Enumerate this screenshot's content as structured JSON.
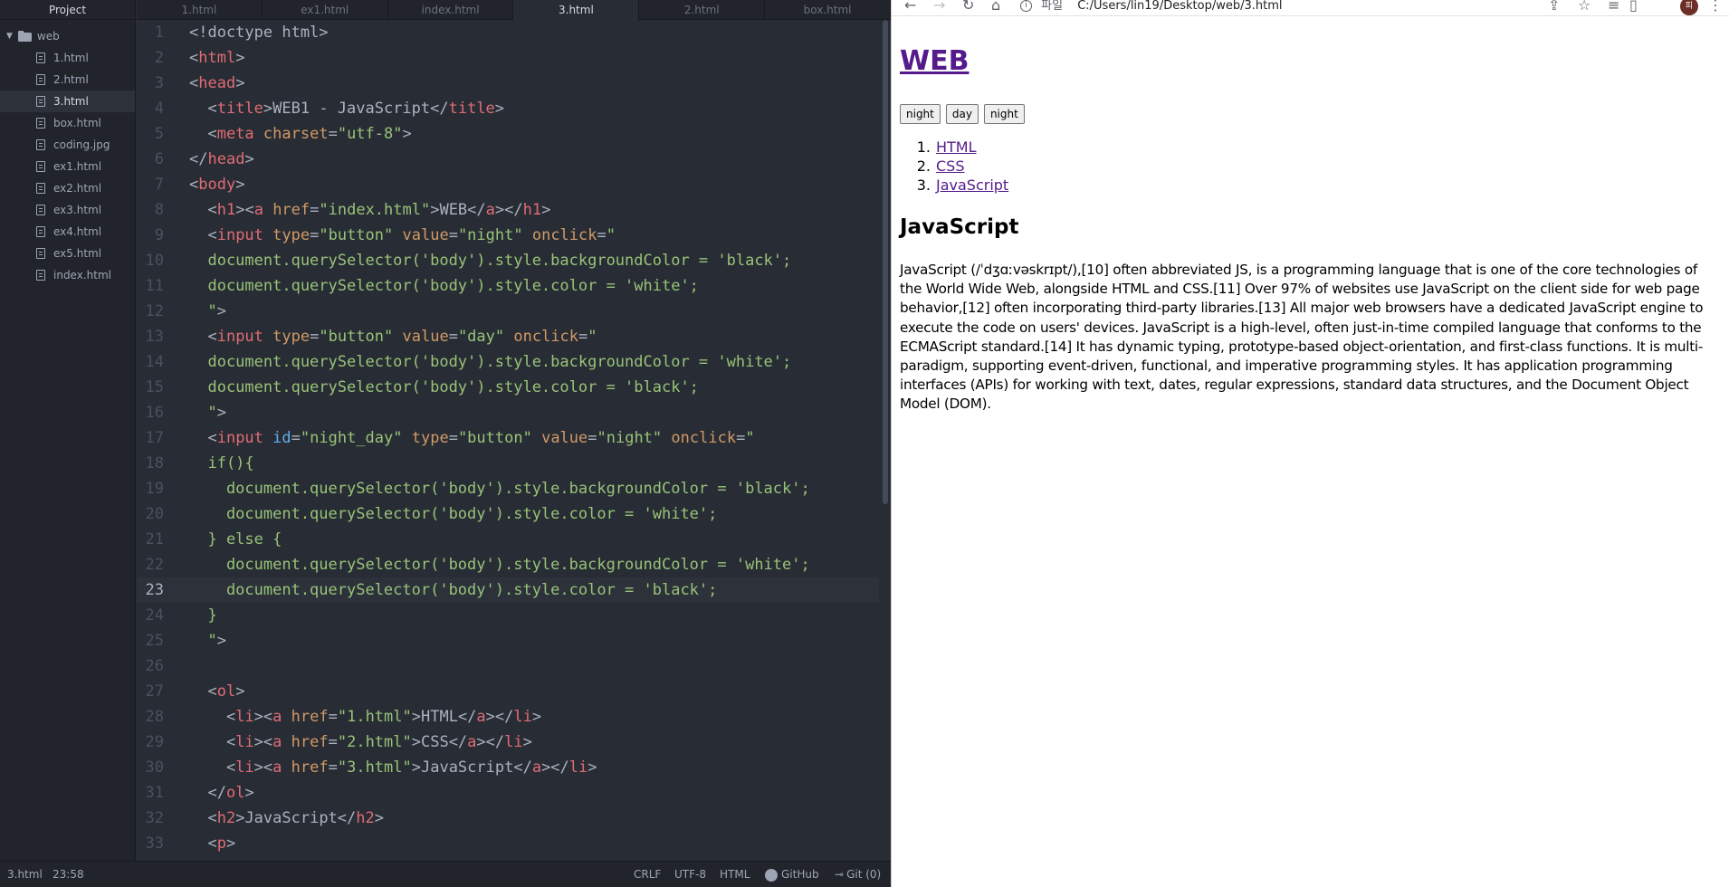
{
  "editor": {
    "tree": {
      "header": "Project",
      "folder": "web",
      "files": [
        "1.html",
        "2.html",
        "3.html",
        "box.html",
        "coding.jpg",
        "ex1.html",
        "ex2.html",
        "ex3.html",
        "ex4.html",
        "ex5.html",
        "index.html"
      ],
      "selected_index": 2
    },
    "tabs": [
      "1.html",
      "ex1.html",
      "index.html",
      "3.html",
      "2.html",
      "box.html"
    ],
    "active_tab_index": 3,
    "current_line": 23,
    "lines": [
      [
        [
          "t-doc",
          "<!doctype html>"
        ]
      ],
      [
        [
          "t-doc",
          "<"
        ],
        [
          "t-tag",
          "html"
        ],
        [
          "t-doc",
          ">"
        ]
      ],
      [
        [
          "t-doc",
          "<"
        ],
        [
          "t-tag",
          "head"
        ],
        [
          "t-doc",
          ">"
        ]
      ],
      [
        [
          "t-doc",
          "  <"
        ],
        [
          "t-tag",
          "title"
        ],
        [
          "t-doc",
          ">WEB1 - JavaScript</"
        ],
        [
          "t-tag",
          "title"
        ],
        [
          "t-doc",
          ">"
        ]
      ],
      [
        [
          "t-doc",
          "  <"
        ],
        [
          "t-tag",
          "meta"
        ],
        [
          "t-doc",
          " "
        ],
        [
          "t-attr",
          "charset"
        ],
        [
          "t-doc",
          "="
        ],
        [
          "t-str",
          "\"utf-8\""
        ],
        [
          "t-doc",
          ">"
        ]
      ],
      [
        [
          "t-doc",
          "</"
        ],
        [
          "t-tag",
          "head"
        ],
        [
          "t-doc",
          ">"
        ]
      ],
      [
        [
          "t-doc",
          "<"
        ],
        [
          "t-tag",
          "body"
        ],
        [
          "t-doc",
          ">"
        ]
      ],
      [
        [
          "t-doc",
          "  <"
        ],
        [
          "t-tag",
          "h1"
        ],
        [
          "t-doc",
          "><"
        ],
        [
          "t-tag",
          "a"
        ],
        [
          "t-doc",
          " "
        ],
        [
          "t-attr",
          "href"
        ],
        [
          "t-doc",
          "="
        ],
        [
          "t-str",
          "\"index.html\""
        ],
        [
          "t-doc",
          ">WEB</"
        ],
        [
          "t-tag",
          "a"
        ],
        [
          "t-doc",
          "></"
        ],
        [
          "t-tag",
          "h1"
        ],
        [
          "t-doc",
          ">"
        ]
      ],
      [
        [
          "t-doc",
          "  <"
        ],
        [
          "t-tag",
          "input"
        ],
        [
          "t-doc",
          " "
        ],
        [
          "t-attr",
          "type"
        ],
        [
          "t-doc",
          "="
        ],
        [
          "t-str",
          "\"button\""
        ],
        [
          "t-doc",
          " "
        ],
        [
          "t-attr",
          "value"
        ],
        [
          "t-doc",
          "="
        ],
        [
          "t-str",
          "\"night\""
        ],
        [
          "t-doc",
          " "
        ],
        [
          "t-attr",
          "onclick"
        ],
        [
          "t-doc",
          "="
        ],
        [
          "t-str",
          "\""
        ]
      ],
      [
        [
          "t-str",
          "  document.querySelector('body').style.backgroundColor = 'black';"
        ]
      ],
      [
        [
          "t-str",
          "  document.querySelector('body').style.color = 'white';"
        ]
      ],
      [
        [
          "t-str",
          "  \""
        ],
        [
          "t-doc",
          ">"
        ]
      ],
      [
        [
          "t-doc",
          "  <"
        ],
        [
          "t-tag",
          "input"
        ],
        [
          "t-doc",
          " "
        ],
        [
          "t-attr",
          "type"
        ],
        [
          "t-doc",
          "="
        ],
        [
          "t-str",
          "\"button\""
        ],
        [
          "t-doc",
          " "
        ],
        [
          "t-attr",
          "value"
        ],
        [
          "t-doc",
          "="
        ],
        [
          "t-str",
          "\"day\""
        ],
        [
          "t-doc",
          " "
        ],
        [
          "t-attr",
          "onclick"
        ],
        [
          "t-doc",
          "="
        ],
        [
          "t-str",
          "\""
        ]
      ],
      [
        [
          "t-str",
          "  document.querySelector('body').style.backgroundColor = 'white';"
        ]
      ],
      [
        [
          "t-str",
          "  document.querySelector('body').style.color = 'black';"
        ]
      ],
      [
        [
          "t-str",
          "  \""
        ],
        [
          "t-doc",
          ">"
        ]
      ],
      [
        [
          "t-doc",
          "  <"
        ],
        [
          "t-tag",
          "input"
        ],
        [
          "t-doc",
          " "
        ],
        [
          "t-id",
          "id"
        ],
        [
          "t-doc",
          "="
        ],
        [
          "t-str",
          "\"night_day\""
        ],
        [
          "t-doc",
          " "
        ],
        [
          "t-attr",
          "type"
        ],
        [
          "t-doc",
          "="
        ],
        [
          "t-str",
          "\"button\""
        ],
        [
          "t-doc",
          " "
        ],
        [
          "t-attr",
          "value"
        ],
        [
          "t-doc",
          "="
        ],
        [
          "t-str",
          "\"night\""
        ],
        [
          "t-doc",
          " "
        ],
        [
          "t-attr",
          "onclick"
        ],
        [
          "t-doc",
          "="
        ],
        [
          "t-str",
          "\""
        ]
      ],
      [
        [
          "t-str",
          "  if(){"
        ]
      ],
      [
        [
          "t-str",
          "    document.querySelector('body').style.backgroundColor = 'black';"
        ]
      ],
      [
        [
          "t-str",
          "    document.querySelector('body').style.color = 'white';"
        ]
      ],
      [
        [
          "t-str",
          "  } else {"
        ]
      ],
      [
        [
          "t-str",
          "    document.querySelector('body').style.backgroundColor = 'white';"
        ]
      ],
      [
        [
          "t-str",
          "    document.querySelector('body').style.color = 'black';"
        ]
      ],
      [
        [
          "t-str",
          "  }"
        ]
      ],
      [
        [
          "t-str",
          "  \""
        ],
        [
          "t-doc",
          ">"
        ]
      ],
      [],
      [
        [
          "t-doc",
          "  <"
        ],
        [
          "t-tag",
          "ol"
        ],
        [
          "t-doc",
          ">"
        ]
      ],
      [
        [
          "t-doc",
          "    <"
        ],
        [
          "t-tag",
          "li"
        ],
        [
          "t-doc",
          "><"
        ],
        [
          "t-tag",
          "a"
        ],
        [
          "t-doc",
          " "
        ],
        [
          "t-attr",
          "href"
        ],
        [
          "t-doc",
          "="
        ],
        [
          "t-str",
          "\"1.html\""
        ],
        [
          "t-doc",
          ">HTML</"
        ],
        [
          "t-tag",
          "a"
        ],
        [
          "t-doc",
          "></"
        ],
        [
          "t-tag",
          "li"
        ],
        [
          "t-doc",
          ">"
        ]
      ],
      [
        [
          "t-doc",
          "    <"
        ],
        [
          "t-tag",
          "li"
        ],
        [
          "t-doc",
          "><"
        ],
        [
          "t-tag",
          "a"
        ],
        [
          "t-doc",
          " "
        ],
        [
          "t-attr",
          "href"
        ],
        [
          "t-doc",
          "="
        ],
        [
          "t-str",
          "\"2.html\""
        ],
        [
          "t-doc",
          ">CSS</"
        ],
        [
          "t-tag",
          "a"
        ],
        [
          "t-doc",
          "></"
        ],
        [
          "t-tag",
          "li"
        ],
        [
          "t-doc",
          ">"
        ]
      ],
      [
        [
          "t-doc",
          "    <"
        ],
        [
          "t-tag",
          "li"
        ],
        [
          "t-doc",
          "><"
        ],
        [
          "t-tag",
          "a"
        ],
        [
          "t-doc",
          " "
        ],
        [
          "t-attr",
          "href"
        ],
        [
          "t-doc",
          "="
        ],
        [
          "t-str",
          "\"3.html\""
        ],
        [
          "t-doc",
          ">JavaScript</"
        ],
        [
          "t-tag",
          "a"
        ],
        [
          "t-doc",
          "></"
        ],
        [
          "t-tag",
          "li"
        ],
        [
          "t-doc",
          ">"
        ]
      ],
      [
        [
          "t-doc",
          "  </"
        ],
        [
          "t-tag",
          "ol"
        ],
        [
          "t-doc",
          ">"
        ]
      ],
      [
        [
          "t-doc",
          "  <"
        ],
        [
          "t-tag",
          "h2"
        ],
        [
          "t-doc",
          ">JavaScript</"
        ],
        [
          "t-tag",
          "h2"
        ],
        [
          "t-doc",
          ">"
        ]
      ],
      [
        [
          "t-doc",
          "  <"
        ],
        [
          "t-tag",
          "p"
        ],
        [
          "t-doc",
          ">"
        ]
      ]
    ],
    "status": {
      "file": "3.html",
      "cursor": "23:58",
      "line_ending": "CRLF",
      "encoding": "UTF-8",
      "grammar": "HTML",
      "github": "GitHub",
      "git": "Git (0)"
    }
  },
  "browser": {
    "omnibox": {
      "info_label": "i",
      "scheme_label": "파일",
      "url": "C:/Users/lin19/Desktop/web/3.html"
    },
    "avatar_initial": "피",
    "page": {
      "h1": "WEB",
      "buttons": [
        "night",
        "day",
        "night"
      ],
      "list": [
        "HTML",
        "CSS",
        "JavaScript"
      ],
      "h2": "JavaScript",
      "paragraph": "JavaScript (/ˈdʒɑːvəskrɪpt/),[10] often abbreviated JS, is a programming language that is one of the core technologies of the World Wide Web, alongside HTML and CSS.[11] Over 97% of websites use JavaScript on the client side for web page behavior,[12] often incorporating third-party libraries.[13] All major web browsers have a dedicated JavaScript engine to execute the code on users' devices. JavaScript is a high-level, often just-in-time compiled language that conforms to the ECMAScript standard.[14] It has dynamic typing, prototype-based object-orientation, and first-class functions. It is multi-paradigm, supporting event-driven, functional, and imperative programming styles. It has application programming interfaces (APIs) for working with text, dates, regular expressions, standard data structures, and the Document Object Model (DOM)."
    }
  },
  "colors": {
    "editor_bg": "#282c34",
    "panel_bg": "#21252b",
    "tag": "#e06c75",
    "attr": "#d19a66",
    "string": "#98c379",
    "id_attr": "#61afef",
    "visited_link": "#551a8b"
  },
  "icons": {
    "folder": "folder-icon",
    "file": "file-icon",
    "back": "back-arrow-icon",
    "forward": "forward-arrow-icon",
    "reload": "reload-icon",
    "home": "home-icon",
    "share": "share-icon",
    "star": "bookmark-star-icon",
    "media": "media-controls-icon",
    "sidepanel": "side-panel-icon",
    "menu": "kebab-menu-icon",
    "github": "github-icon",
    "git": "git-commit-icon"
  }
}
